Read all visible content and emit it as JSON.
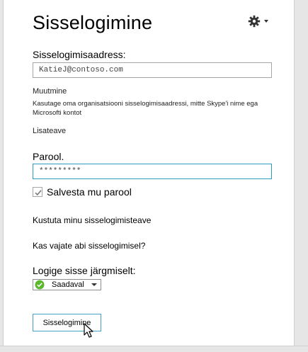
{
  "header": {
    "title": "Sisselogimine",
    "settings_icon": "gear-icon"
  },
  "form": {
    "address_label": "Sisselogimisaadress:",
    "address_value": "KatieJ@contoso.com",
    "change_label": "Muutmine",
    "change_help": "Kasutage oma organisatsiooni sisselogimisaadressi, mitte Skype'i nime ega Microsofti kontot",
    "more_info_label": "Lisateave",
    "password_label": "Parool.",
    "password_value": "*********",
    "save_password_label": "Salvesta mu parool",
    "save_password_checked": true
  },
  "links": {
    "delete_info": "Kustuta minu sisselogimisteave",
    "help": "Kas vajate abi sisselogimisel?"
  },
  "status": {
    "label": "Logige sisse järgmiselt:",
    "selected": "Saadaval",
    "color": "#5cb82e"
  },
  "actions": {
    "signin_label": "Sisselogimine"
  },
  "colors": {
    "focus_border": "#2e9bc1",
    "button_border": "#44a2c4"
  }
}
